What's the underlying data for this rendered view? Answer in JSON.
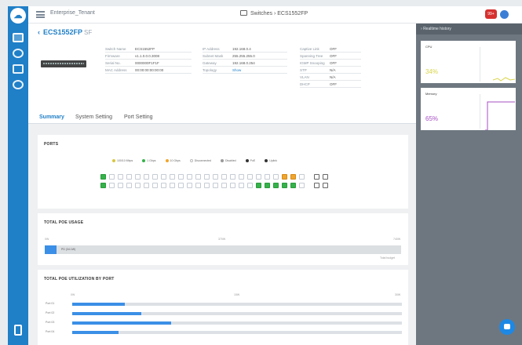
{
  "app": {
    "tenant": "Enterprise_Tenant",
    "breadcrumb": "Switches › ECS1552FP",
    "alert_badge": "99+"
  },
  "device": {
    "name": "ECS1552FP",
    "suffix": "SF",
    "info_col1": [
      {
        "label": "Switch Name",
        "value": "ECS1552FP"
      },
      {
        "label": "Firmware",
        "value": "v1.1.0.0.0.3008"
      },
      {
        "label": "Serial No.",
        "value": "0000000F1F1F"
      },
      {
        "label": "MAC Address",
        "value": "00:00:00:00:00:00"
      }
    ],
    "info_col2": [
      {
        "label": "IP Address",
        "value": "192.168.0.4"
      },
      {
        "label": "Subnet Mask",
        "value": "255.255.255.0"
      },
      {
        "label": "Gateway",
        "value": "192.168.0.254"
      },
      {
        "label": "Topology",
        "value": "Show"
      }
    ],
    "info_col3": [
      {
        "label": "Captive Link",
        "value": "OFF"
      },
      {
        "label": "Spanning Tree",
        "value": "OFF"
      },
      {
        "label": "IGMP Snooping",
        "value": "OFF"
      },
      {
        "label": "STP",
        "value": "N/A"
      },
      {
        "label": "VLAN",
        "value": "N/A"
      },
      {
        "label": "DHCP",
        "value": "OFF"
      }
    ]
  },
  "tabs": [
    "Summary",
    "System Setting",
    "Port Setting"
  ],
  "ports_card": {
    "title": "PORTS",
    "legend": [
      "100/10 Mbps",
      "1 Gbps",
      "10 Gbps",
      "Disconnected",
      "Disabled",
      "PoE",
      "Uplink"
    ]
  },
  "poe_card": {
    "title": "TOTAL POE USAGE",
    "axis": [
      "0W",
      "370W",
      "740W"
    ],
    "bar_label": "PD (34.1W)",
    "footer": "Total budget",
    "fraction": 0.03
  },
  "poe_port_card": {
    "title": "TOTAL POE UTILIZATION BY PORT",
    "axis": [
      "0W",
      "15W",
      "30W"
    ],
    "rows": [
      {
        "label": "Port 01",
        "fraction": 0.16
      },
      {
        "label": "Port 02",
        "fraction": 0.21
      },
      {
        "label": "Port 03",
        "fraction": 0.3
      },
      {
        "label": "Port 04",
        "fraction": 0.14
      }
    ]
  },
  "realtime": {
    "title": "Realtime history",
    "cpu_label": "CPU",
    "cpu_value": "34%",
    "mem_label": "Memory",
    "mem_value": "65%",
    "colors": {
      "cpu": "#d9d54a",
      "mem": "#a54fc3"
    }
  }
}
